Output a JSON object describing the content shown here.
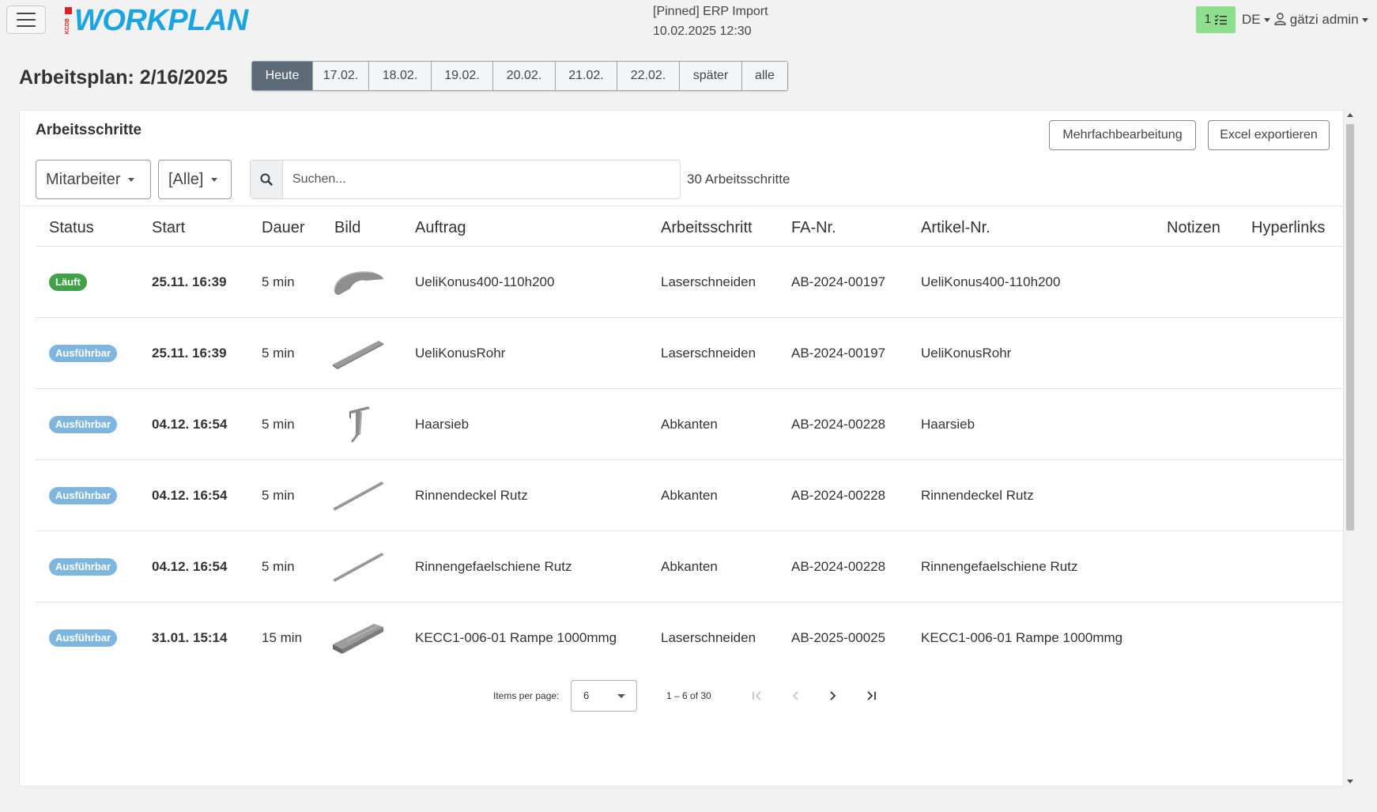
{
  "header": {
    "logo_badge": "KCDB",
    "logo_text": "WORKPLAN",
    "sync_line1": "[Pinned] ERP Import",
    "sync_line2": "10.02.2025 12:30",
    "task_count": "1",
    "language": "DE",
    "user": "gätzi admin"
  },
  "page": {
    "title": "Arbeitsplan: 2/16/2025",
    "date_tabs": [
      "Heute",
      "17.02.",
      "18.02.",
      "19.02.",
      "20.02.",
      "21.02.",
      "22.02.",
      "später",
      "alle"
    ],
    "active_tab": "Heute"
  },
  "card": {
    "title": "Arbeitsschritte",
    "bulk_edit_label": "Mehrfachbearbeitung",
    "excel_export_label": "Excel exportieren",
    "employee_filter": "Mitarbeiter",
    "status_filter": "[Alle]",
    "search_placeholder": "Suchen...",
    "count_text": "30 Arbeitsschritte"
  },
  "table": {
    "columns": [
      "Status",
      "Start",
      "Dauer",
      "Bild",
      "Auftrag",
      "Arbeitsschritt",
      "FA-Nr.",
      "Artikel-Nr.",
      "Notizen",
      "Hyperlinks"
    ],
    "rows": [
      {
        "status": "Läuft",
        "status_type": "running",
        "start": "25.11. 16:39",
        "duration": "5 min",
        "image": "cone-segment",
        "order": "UeliKonus400-110h200",
        "step": "Laserschneiden",
        "fa": "AB-2024-00197",
        "article": "UeliKonus400-110h200",
        "notes": "",
        "links": ""
      },
      {
        "status": "Ausführbar",
        "status_type": "ready",
        "start": "25.11. 16:39",
        "duration": "5 min",
        "image": "flat-plate",
        "order": "UeliKonusRohr",
        "step": "Laserschneiden",
        "fa": "AB-2024-00197",
        "article": "UeliKonusRohr",
        "notes": "",
        "links": ""
      },
      {
        "status": "Ausführbar",
        "status_type": "ready",
        "start": "04.12. 16:54",
        "duration": "5 min",
        "image": "bracket",
        "order": "Haarsieb",
        "step": "Abkanten",
        "fa": "AB-2024-00228",
        "article": "Haarsieb",
        "notes": "",
        "links": ""
      },
      {
        "status": "Ausführbar",
        "status_type": "ready",
        "start": "04.12. 16:54",
        "duration": "5 min",
        "image": "thin-rail",
        "order": "Rinnendeckel Rutz",
        "step": "Abkanten",
        "fa": "AB-2024-00228",
        "article": "Rinnendeckel Rutz",
        "notes": "",
        "links": ""
      },
      {
        "status": "Ausführbar",
        "status_type": "ready",
        "start": "04.12. 16:54",
        "duration": "5 min",
        "image": "thin-rail",
        "order": "Rinnengefaelschiene Rutz",
        "step": "Abkanten",
        "fa": "AB-2024-00228",
        "article": "Rinnengefaelschiene Rutz",
        "notes": "",
        "links": ""
      },
      {
        "status": "Ausführbar",
        "status_type": "ready",
        "start": "31.01. 15:14",
        "duration": "15 min",
        "image": "ramp",
        "order": "KECC1-006-01 Rampe 1000mmg",
        "step": "Laserschneiden",
        "fa": "AB-2025-00025",
        "article": "KECC1-006-01 Rampe 1000mmg",
        "notes": "",
        "links": ""
      }
    ]
  },
  "paginator": {
    "label": "Items per page:",
    "page_size": "6",
    "range": "1 – 6 of 30"
  },
  "colors": {
    "logo_blue": "#1ba4e0",
    "running_green": "#3fa248",
    "ready_blue": "#7eb6e0",
    "active_tab": "#5d6b78",
    "counter_green": "#8ee08e"
  }
}
